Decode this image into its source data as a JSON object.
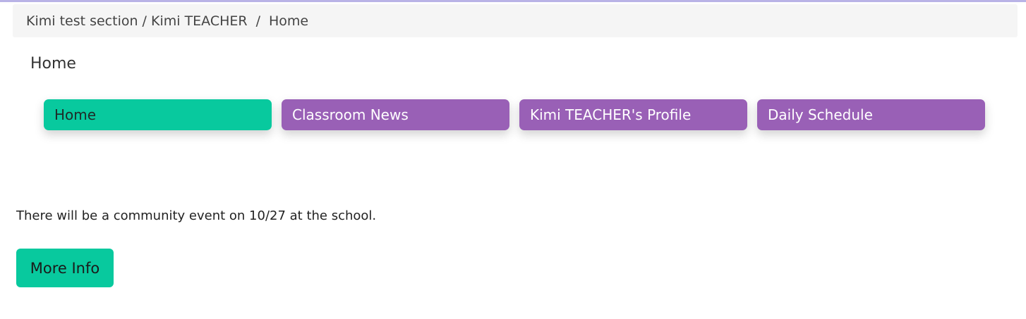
{
  "breadcrumb": {
    "section": "Kimi test section / Kimi TEACHER",
    "separator": "/",
    "current": "Home"
  },
  "page": {
    "title": "Home"
  },
  "nav": {
    "tabs": [
      {
        "label": "Home",
        "active": true
      },
      {
        "label": "Classroom News",
        "active": false
      },
      {
        "label": "Kimi TEACHER's Profile",
        "active": false
      },
      {
        "label": "Daily Schedule",
        "active": false
      }
    ]
  },
  "content": {
    "message": "There will be a community event on 10/27 at the school.",
    "more_info_label": "More Info"
  },
  "colors": {
    "accent_green": "#08c99e",
    "accent_purple": "#9960b6",
    "breadcrumb_bg": "#f5f5f5"
  }
}
